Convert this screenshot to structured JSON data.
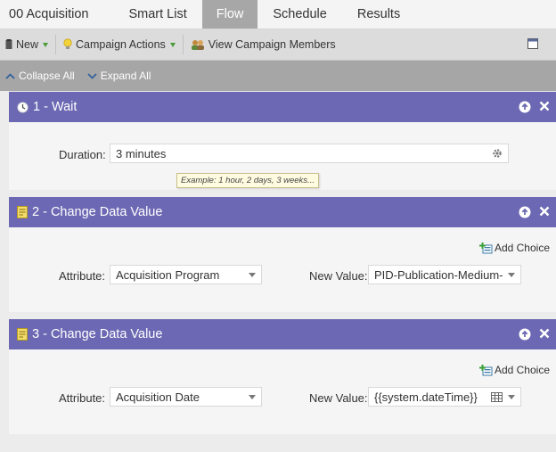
{
  "tabs": [
    {
      "label": "00 Acquisition",
      "active": false
    },
    {
      "label": "Smart List",
      "active": false
    },
    {
      "label": "Flow",
      "active": true
    },
    {
      "label": "Schedule",
      "active": false
    },
    {
      "label": "Results",
      "active": false
    }
  ],
  "toolbar": {
    "new_label": "New",
    "campaign_actions_label": "Campaign Actions",
    "view_members_label": "View Campaign Members"
  },
  "subbar": {
    "collapse_label": "Collapse All",
    "expand_label": "Expand All"
  },
  "steps": [
    {
      "title": "1 - Wait",
      "duration_label": "Duration:",
      "duration_value": "3 minutes",
      "tooltip": "Example: 1 hour, 2 days, 3 weeks..."
    },
    {
      "title": "2 - Change Data Value",
      "add_choice_label": "Add Choice",
      "attribute_label": "Attribute:",
      "attribute_value": "Acquisition Program",
      "new_value_label": "New Value:",
      "new_value": "PID-Publication-Medium-"
    },
    {
      "title": "3 - Change Data Value",
      "add_choice_label": "Add Choice",
      "attribute_label": "Attribute:",
      "attribute_value": "Acquisition Date",
      "new_value_label": "New Value:",
      "new_value": "{{system.dateTime}}"
    }
  ],
  "colors": {
    "header_purple": "#6c68b3",
    "active_tab": "#a7a7a7",
    "subbar": "#a6a6a6"
  }
}
